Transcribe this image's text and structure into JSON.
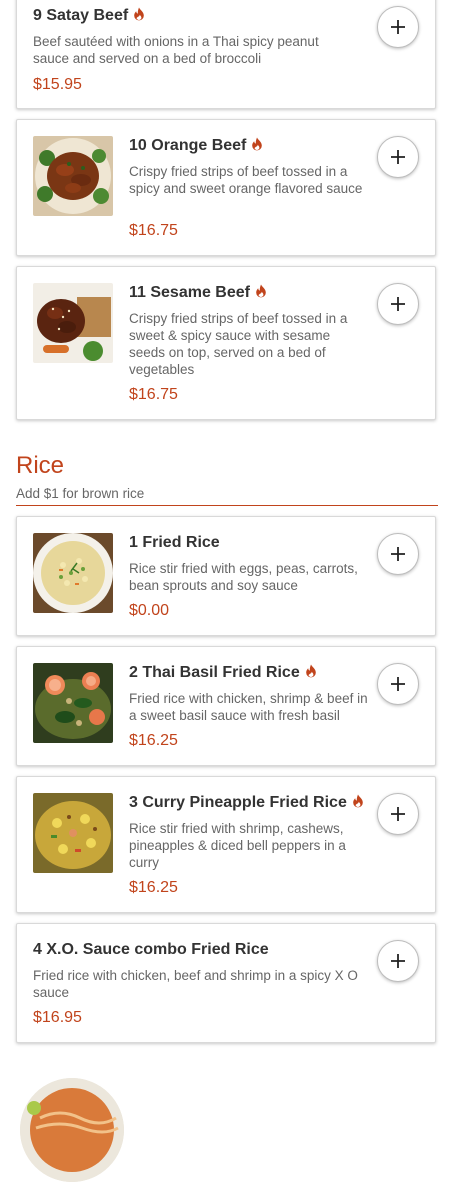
{
  "colors": {
    "accent": "#c1441c",
    "text": "#333333",
    "muted": "#666666"
  },
  "items_top": [
    {
      "name": "9 Satay Beef",
      "spicy": true,
      "description": "Beef sautéed with onions in a Thai spicy peanut sauce and served on a bed of broccoli",
      "price": "$15.95",
      "image": null
    },
    {
      "name": "10 Orange Beef",
      "spicy": true,
      "description": "Crispy fried strips of beef tossed in a spicy and sweet orange flavored sauce",
      "price": "$16.75",
      "image": "orange-beef"
    },
    {
      "name": "11 Sesame Beef",
      "spicy": true,
      "description": "Crispy fried strips of beef tossed in a sweet & spicy sauce with sesame seeds on top, served on a bed of vegetables",
      "price": "$16.75",
      "image": "sesame-beef"
    }
  ],
  "rice_section": {
    "title": "Rice",
    "subtitle": "Add $1 for brown rice",
    "items": [
      {
        "name": "1 Fried Rice",
        "spicy": false,
        "description": "Rice stir fried with eggs, peas, carrots, bean sprouts and soy sauce",
        "price": "$0.00",
        "image": "fried-rice"
      },
      {
        "name": "2 Thai Basil Fried Rice",
        "spicy": true,
        "description": "Fried rice with chicken, shrimp & beef in a sweet basil sauce with fresh basil",
        "price": "$16.25",
        "image": "basil-fried-rice"
      },
      {
        "name": "3 Curry Pineapple Fried Rice",
        "spicy": true,
        "description": "Rice stir fried with shrimp, cashews, pineapples & diced bell peppers in a curry",
        "price": "$16.25",
        "image": "curry-pineapple-rice"
      },
      {
        "name": "4 X.O. Sauce combo Fried Rice",
        "spicy": false,
        "description": "Fried rice with chicken, beef and shrimp in a spicy X O sauce",
        "price": "$16.95",
        "image": null
      }
    ]
  },
  "icons": {
    "add": "plus-icon",
    "spicy": "flame-icon"
  }
}
